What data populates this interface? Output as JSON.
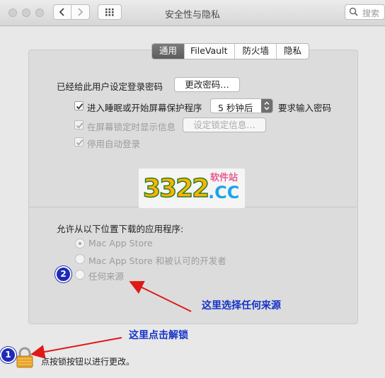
{
  "window": {
    "title": "安全性与隐私",
    "back_icon": "chevron-left-icon",
    "forward_icon": "chevron-right-icon",
    "grid_icon": "show-all-grid-icon",
    "search_placeholder": "搜索"
  },
  "tabs": [
    {
      "label": "通用",
      "selected": true
    },
    {
      "label": "FileVault",
      "selected": false
    },
    {
      "label": "防火墙",
      "selected": false
    },
    {
      "label": "隐私",
      "selected": false
    }
  ],
  "general": {
    "password_set_label": "已经给此用户设定登录密码",
    "change_password_button": "更改密码…",
    "require_password": {
      "label": "进入睡眠或开始屏幕保护程序",
      "checked": true,
      "delay": "5 秒钟后",
      "suffix": "要求输入密码"
    },
    "show_message": {
      "label": "在屏幕锁定时显示信息",
      "checked": true,
      "disabled": true,
      "button": "设定锁定信息…"
    },
    "disable_auto_login": {
      "label": "停用自动登录",
      "checked": true,
      "disabled": true
    }
  },
  "downloads": {
    "heading": "允许从以下位置下载的应用程序:",
    "options": [
      {
        "label": "Mac App Store",
        "selected": true
      },
      {
        "label": "Mac App Store 和被认可的开发者",
        "selected": false
      },
      {
        "label": "任何来源",
        "selected": false
      }
    ]
  },
  "watermark": {
    "digits": "3322",
    "cn_text": "软件站",
    "domain_text": ".CC"
  },
  "annotations": {
    "step1_number": "1",
    "step1_text": "这里点击解锁",
    "step2_number": "2",
    "step2_text": "这里选择任何来源",
    "arrow_color": "#e01818",
    "text_color": "#1633c7"
  },
  "footer": {
    "lock_icon": "lock-icon",
    "text": "点按锁按钮以进行更改。"
  }
}
